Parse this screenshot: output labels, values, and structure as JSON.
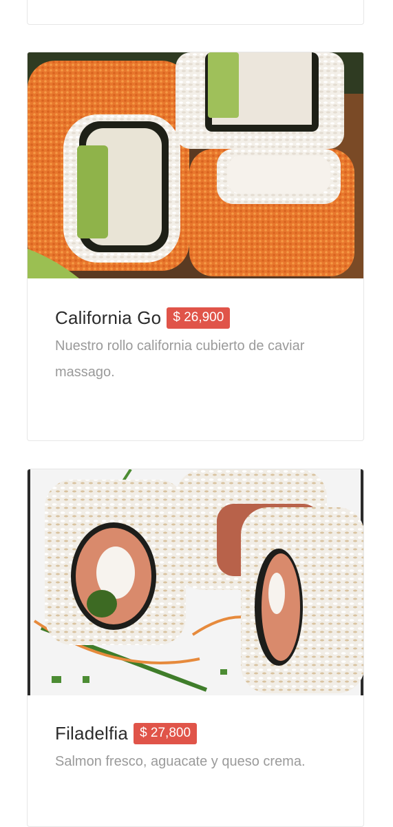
{
  "menu_items": [
    {
      "name": "California Go",
      "price": "$ 26,900",
      "description": "Nuestro rollo california cubierto de caviar massago.",
      "image": "california-roll-photo"
    },
    {
      "name": "Filadelfia",
      "price": "$ 27,800",
      "description": "Salmon fresco, aguacate y queso crema.",
      "image": "philadelphia-roll-photo"
    }
  ],
  "colors": {
    "price_badge": "#e05449",
    "title": "#2b2b2b",
    "description": "#9a9a9a"
  }
}
